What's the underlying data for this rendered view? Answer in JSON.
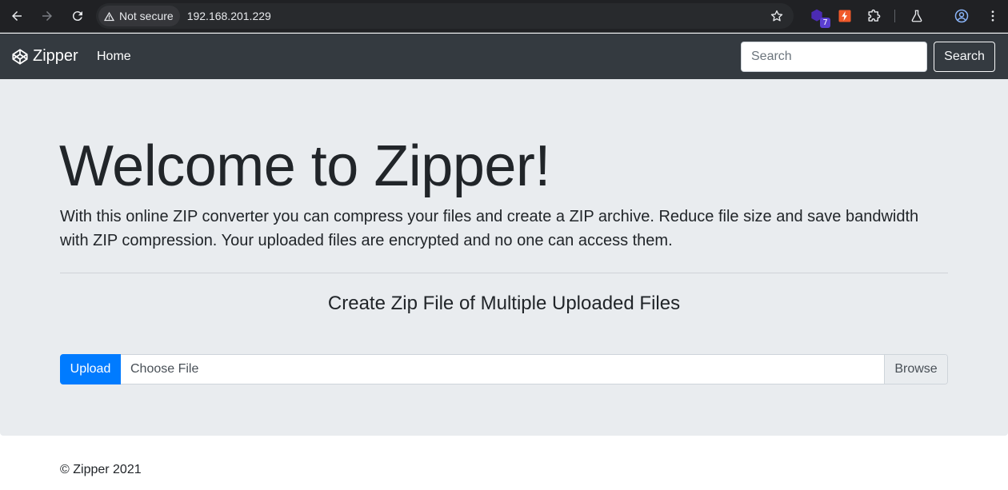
{
  "browser": {
    "security_label": "Not secure",
    "url": "192.168.201.229",
    "extension_badge": "7"
  },
  "navbar": {
    "brand": "Zipper",
    "home_link": "Home",
    "search_placeholder": "Search",
    "search_button": "Search"
  },
  "hero": {
    "title": "Welcome to Zipper!",
    "lead": "With this online ZIP converter you can compress your files and create a ZIP archive. Reduce file size and save bandwidth with ZIP compression. Your uploaded files are encrypted and no one can access them.",
    "section_title": "Create Zip File of Multiple Uploaded Files"
  },
  "upload": {
    "upload_button": "Upload",
    "file_placeholder": "Choose File",
    "browse_button": "Browse"
  },
  "footer": {
    "text": "© Zipper 2021"
  },
  "colors": {
    "navbar_bg": "#343a40",
    "jumbotron_bg": "#e9ecef",
    "primary": "#007bff",
    "browser_bg": "#202124"
  },
  "icons": {
    "back": "arrow-left-icon",
    "forward": "arrow-right-icon",
    "reload": "reload-icon",
    "warning": "warning-triangle-icon",
    "bookmark": "star-icon",
    "brand": "codepen-cube-icon"
  }
}
